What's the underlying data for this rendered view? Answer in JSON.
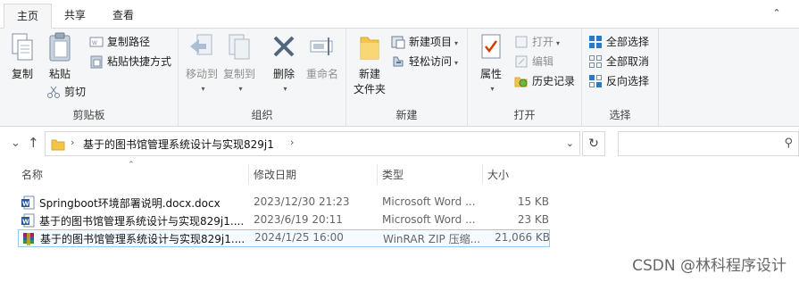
{
  "tabs": [
    "主页",
    "共享",
    "查看"
  ],
  "ribbon": {
    "clipboard": {
      "label": "剪贴板",
      "pin": "",
      "copy": "复制",
      "paste": "粘贴",
      "copy_path": "复制路径",
      "paste_shortcut": "粘贴快捷方式",
      "cut": "剪切"
    },
    "organize": {
      "label": "组织",
      "move_to": "移动到",
      "copy_to": "复制到",
      "delete": "删除",
      "rename": "重命名"
    },
    "new": {
      "label": "新建",
      "new_folder_line1": "新建",
      "new_folder_line2": "文件夹",
      "new_item": "新建项目",
      "easy_access": "轻松访问"
    },
    "open": {
      "label": "打开",
      "properties": "属性",
      "open": "打开",
      "edit": "编辑",
      "history": "历史记录"
    },
    "select": {
      "label": "选择",
      "select_all": "全部选择",
      "select_none": "全部取消",
      "invert": "反向选择"
    }
  },
  "address": {
    "path": "基于的图书馆管理系统设计与实现829j1",
    "search_placeholder": ""
  },
  "columns": {
    "name": "名称",
    "date": "修改日期",
    "type": "类型",
    "size": "大小"
  },
  "files": [
    {
      "name": "Springboot环境部署说明.docx.docx",
      "date": "2023/12/30 21:23",
      "type": "Microsoft Word ...",
      "size": "15 KB",
      "icon": "word-icon"
    },
    {
      "name": "基于的图书馆管理系统设计与实现829j1....",
      "date": "2023/6/19 20:11",
      "type": "Microsoft Word ...",
      "size": "23 KB",
      "icon": "word-icon"
    },
    {
      "name": "基于的图书馆管理系统设计与实现829j1....",
      "date": "2024/1/25 16:00",
      "type": "WinRAR ZIP 压缩...",
      "size": "21,066 KB",
      "icon": "winrar-icon"
    }
  ],
  "watermark": "CSDN @林科程序设计",
  "colors": {
    "ribbon_bg": "#f5f6f7",
    "selection_border": "#99c9ef",
    "folder": "#f2c44b",
    "word_blue": "#2b579a",
    "winrar": "#a01d6a"
  }
}
